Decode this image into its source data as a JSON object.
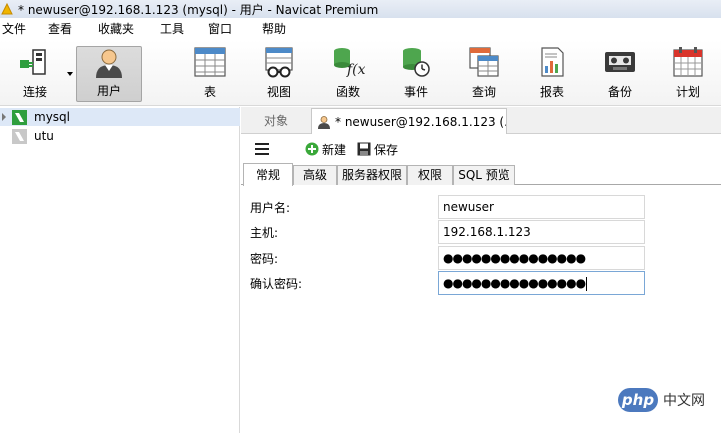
{
  "window": {
    "title": "* newuser@192.168.1.123 (mysql) - 用户 - Navicat Premium"
  },
  "menu": {
    "items": [
      "文件",
      "查看",
      "收藏夹",
      "工具",
      "窗口",
      "帮助"
    ]
  },
  "toolbar": {
    "items": [
      {
        "label": "连接",
        "icon": "plug-icon"
      },
      {
        "label": "用户",
        "icon": "user-icon"
      },
      {
        "label": "表",
        "icon": "table-icon"
      },
      {
        "label": "视图",
        "icon": "view-icon"
      },
      {
        "label": "函数",
        "icon": "function-icon"
      },
      {
        "label": "事件",
        "icon": "event-icon"
      },
      {
        "label": "查询",
        "icon": "query-icon"
      },
      {
        "label": "报表",
        "icon": "report-icon"
      },
      {
        "label": "备份",
        "icon": "backup-icon"
      },
      {
        "label": "计划",
        "icon": "calendar-icon"
      }
    ],
    "active": "用户"
  },
  "sidebar": {
    "connections": [
      {
        "name": "mysql",
        "selected": true
      },
      {
        "name": "utu",
        "selected": false
      }
    ]
  },
  "tabs": {
    "objects_label": "对象",
    "user_tab_label": "* newuser@192.168.1.123 (..."
  },
  "subtoolbar": {
    "new_label": "新建",
    "save_label": "保存"
  },
  "form_tabs": [
    "常规",
    "高级",
    "服务器权限",
    "权限",
    "SQL 预览"
  ],
  "form": {
    "username_label": "用户名:",
    "username_value": "newuser",
    "host_label": "主机:",
    "host_value": "192.168.1.123",
    "password_label": "密码:",
    "password_value": "●●●●●●●●●●●●●●●",
    "confirm_label": "确认密码:",
    "confirm_value": "●●●●●●●●●●●●●●●"
  },
  "watermark": {
    "logo": "php",
    "text": "中文网"
  },
  "colors": {
    "selection": "#dde8f7",
    "accent_blue": "#4c79be",
    "green": "#2e9e3e"
  }
}
